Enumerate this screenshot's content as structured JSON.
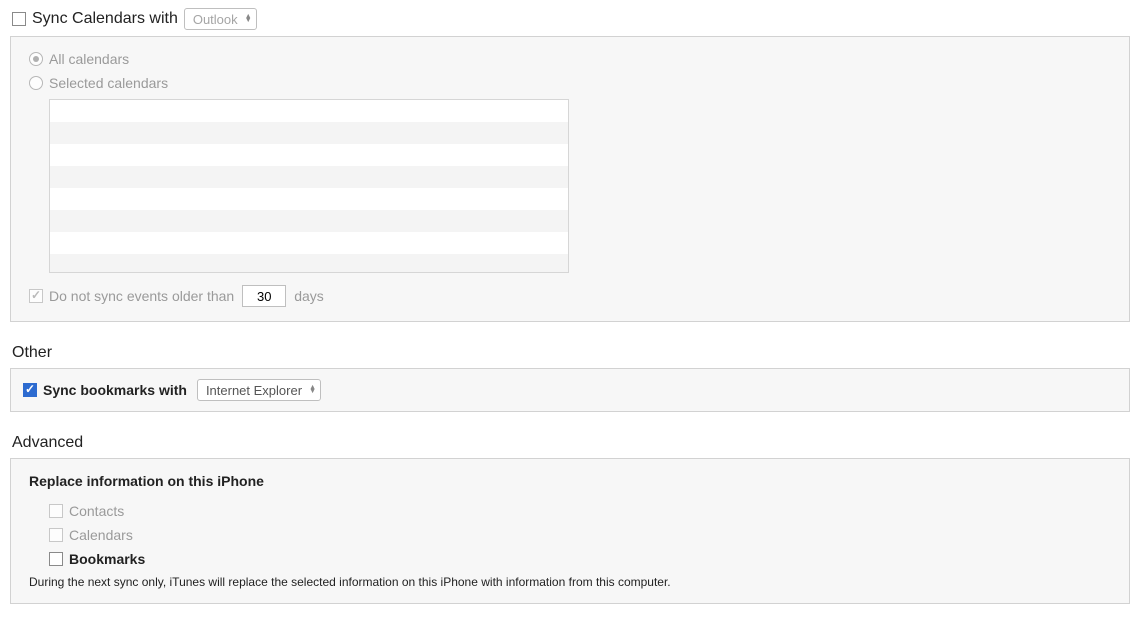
{
  "calendars": {
    "title": "Sync Calendars with",
    "app_select": "Outlook",
    "enabled": false,
    "mode_all": "All calendars",
    "mode_selected": "Selected calendars",
    "age_limit": {
      "label_pre": "Do not sync events older than",
      "value": "30",
      "label_post": "days",
      "checked": true
    }
  },
  "other": {
    "heading": "Other",
    "bookmarks_label": "Sync bookmarks with",
    "bookmarks_app": "Internet Explorer",
    "bookmarks_checked": true
  },
  "advanced": {
    "heading": "Advanced",
    "replace_heading": "Replace information on this iPhone",
    "options": {
      "contacts": "Contacts",
      "calendars": "Calendars",
      "bookmarks": "Bookmarks"
    },
    "note": "During the next sync only, iTunes will replace the selected information on this iPhone with information from this computer."
  }
}
